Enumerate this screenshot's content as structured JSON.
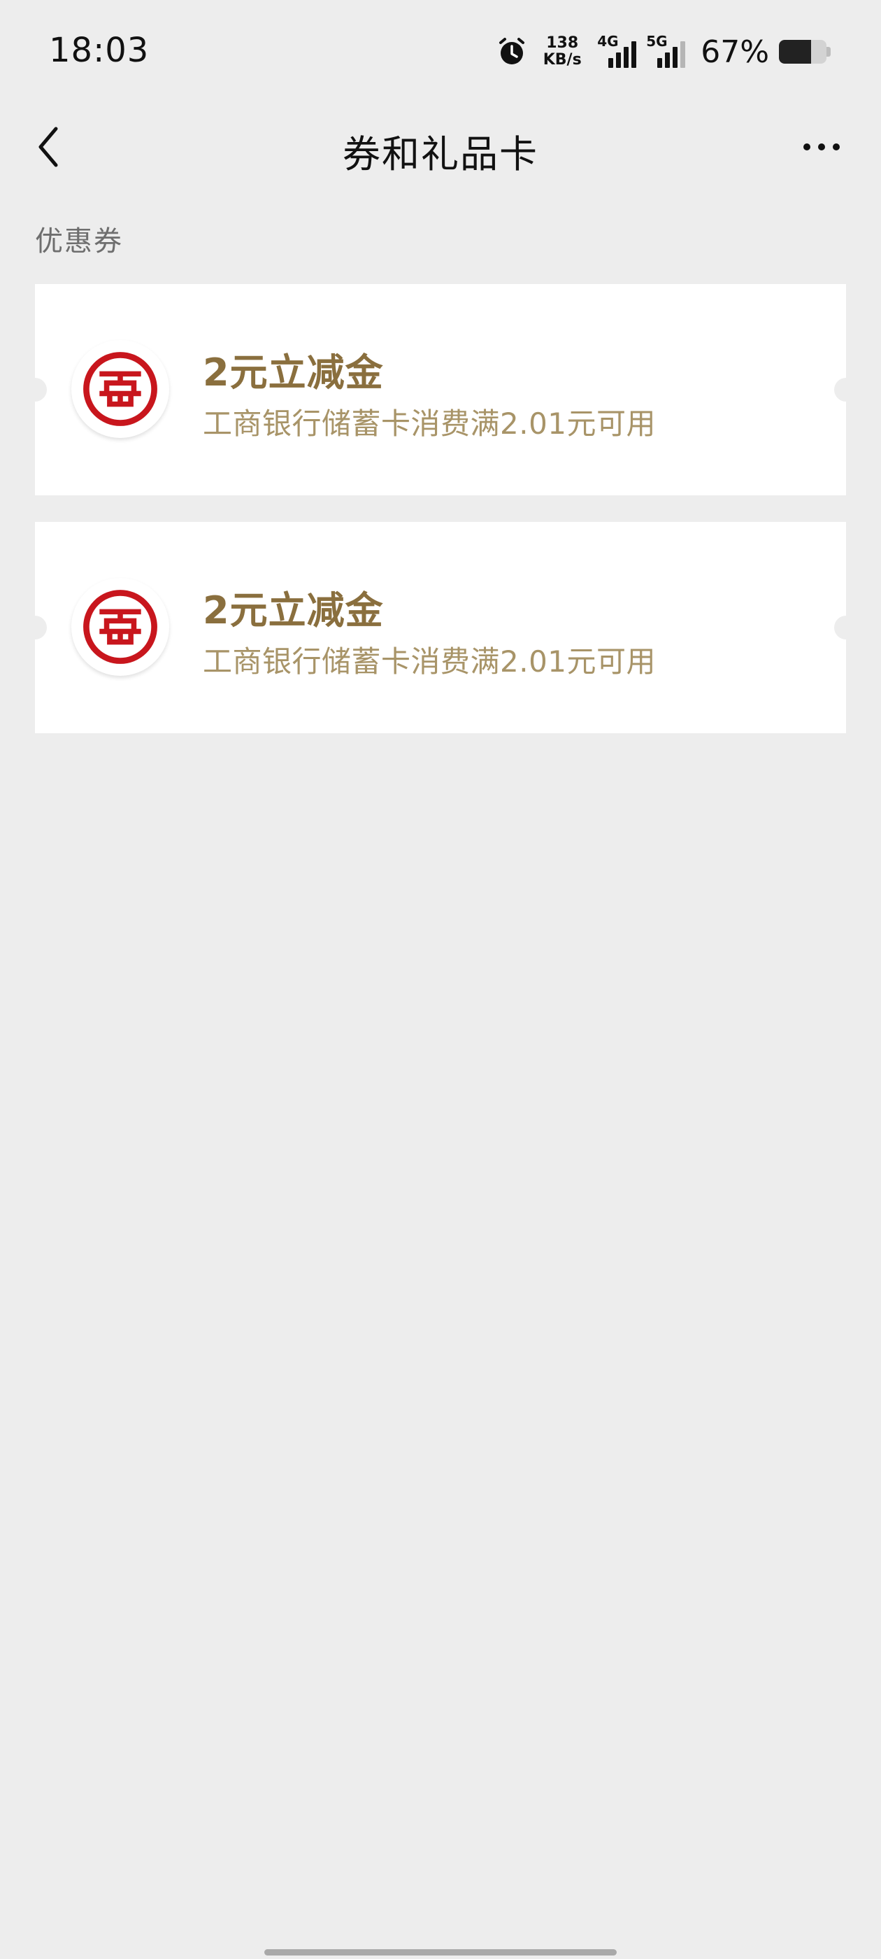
{
  "status_bar": {
    "time": "18:03",
    "net_speed_value": "138",
    "net_speed_unit": "KB/s",
    "signal_1_label": "4G",
    "signal_2_label": "5G",
    "battery_percent": "67%",
    "battery_level": 0.67
  },
  "nav": {
    "title": "券和礼品卡"
  },
  "section": {
    "label": "优惠券"
  },
  "coupons": [
    {
      "title": "2元立减金",
      "desc": "工商银行储蓄卡消费满2.01元可用"
    },
    {
      "title": "2元立减金",
      "desc": "工商银行储蓄卡消费满2.01元可用"
    }
  ],
  "colors": {
    "background": "#ededed",
    "card": "#ffffff",
    "coupon_title": "#8a6f3e",
    "coupon_desc": "#a89468",
    "icbc_red": "#c8161d"
  },
  "icons": {
    "back": "chevron-left-icon",
    "more": "more-dots-icon",
    "alarm": "alarm-clock-icon",
    "bank_logo": "icbc-logo-icon"
  }
}
